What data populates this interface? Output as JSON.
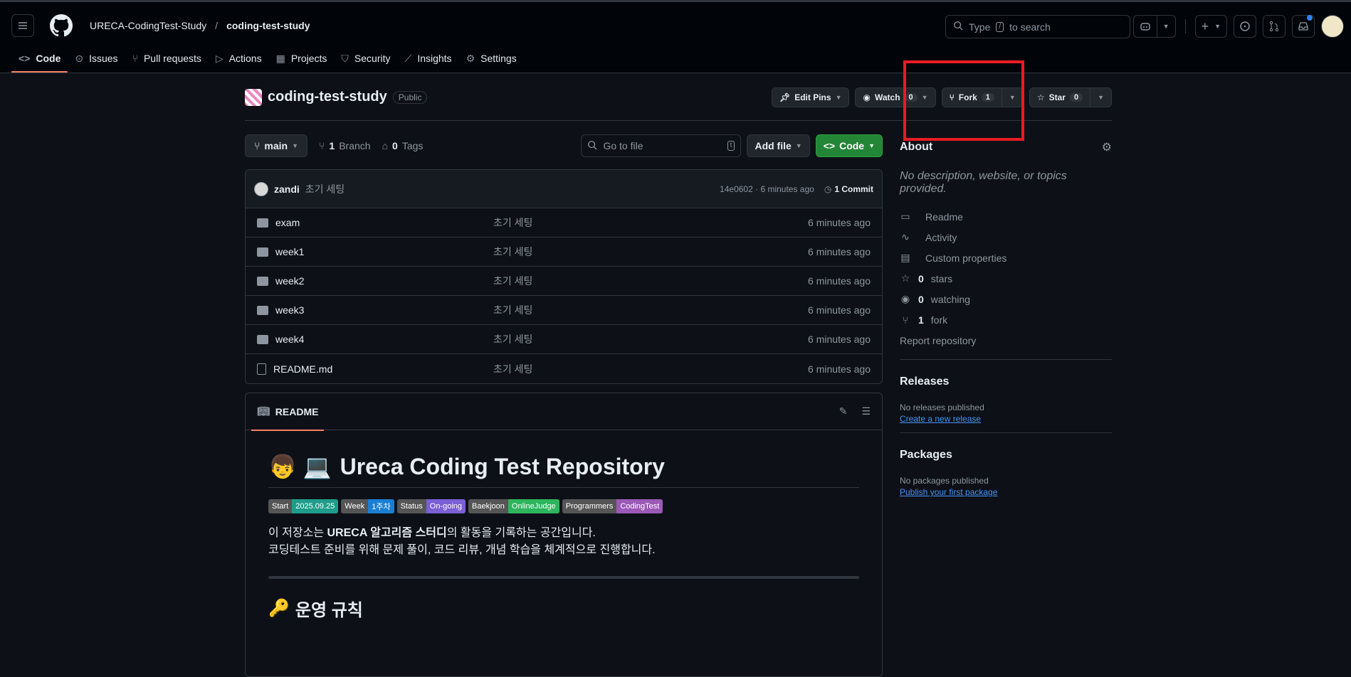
{
  "header": {
    "owner": "URECA-CodingTest-Study",
    "separator": "/",
    "repo": "coding-test-study",
    "search_placeholder_pre": "Type",
    "search_key": "/",
    "search_placeholder_post": "to search"
  },
  "tabs": [
    {
      "label": "Code",
      "icon": "code-icon"
    },
    {
      "label": "Issues",
      "icon": "issue-icon"
    },
    {
      "label": "Pull requests",
      "icon": "pull-request-icon"
    },
    {
      "label": "Actions",
      "icon": "play-icon"
    },
    {
      "label": "Projects",
      "icon": "table-icon"
    },
    {
      "label": "Security",
      "icon": "shield-icon"
    },
    {
      "label": "Insights",
      "icon": "graph-icon"
    },
    {
      "label": "Settings",
      "icon": "gear-icon"
    }
  ],
  "repo": {
    "name": "coding-test-study",
    "visibility": "Public",
    "edit_pins": "Edit Pins",
    "watch": "Watch",
    "watch_count": "0",
    "fork": "Fork",
    "fork_count": "1",
    "star": "Star",
    "star_count": "0"
  },
  "toolbar": {
    "branch": "main",
    "branch_count": "1",
    "branch_label": "Branch",
    "tag_count": "0",
    "tag_label": "Tags",
    "goto_placeholder": "Go to file",
    "goto_key": "t",
    "add_file": "Add file",
    "code": "Code"
  },
  "commit": {
    "author": "zandi",
    "message": "초기 세팅",
    "sha_time": "14e0602 · 6 minutes ago",
    "count": "1 Commit"
  },
  "files": [
    {
      "name": "exam",
      "type": "folder",
      "message": "초기 세팅",
      "time": "6 minutes ago"
    },
    {
      "name": "week1",
      "type": "folder",
      "message": "초기 세팅",
      "time": "6 minutes ago"
    },
    {
      "name": "week2",
      "type": "folder",
      "message": "초기 세팅",
      "time": "6 minutes ago"
    },
    {
      "name": "week3",
      "type": "folder",
      "message": "초기 세팅",
      "time": "6 minutes ago"
    },
    {
      "name": "week4",
      "type": "folder",
      "message": "초기 세팅",
      "time": "6 minutes ago"
    },
    {
      "name": "README.md",
      "type": "file",
      "message": "초기 세팅",
      "time": "6 minutes ago"
    }
  ],
  "readme": {
    "tab": "README",
    "title_emoji": "👦 💻",
    "title": "Ureca Coding Test Repository",
    "badges": [
      {
        "label": "Start",
        "value": "2025.09.25",
        "color": "#1f9c8a"
      },
      {
        "label": "Week",
        "value": "1주차",
        "color": "#1a7fd4"
      },
      {
        "label": "Status",
        "value": "On-going",
        "color": "#7b5fd6"
      },
      {
        "label": "Baekjoon",
        "value": "OnlineJudge",
        "color": "#2db55d"
      },
      {
        "label": "Programmers",
        "value": "CodingTest",
        "color": "#9b59b6"
      }
    ],
    "para_pre": "이 저장소는 ",
    "para_bold": "URECA 알고리즘 스터디",
    "para_post": "의 활동을 기록하는 공간입니다.",
    "para2": "코딩테스트 준비를 위해 문제 풀이, 코드 리뷰, 개념 학습을 체계적으로 진행합니다.",
    "h2_emoji": "🔑",
    "h2": "운영 규칙"
  },
  "about": {
    "title": "About",
    "description": "No description, website, or topics provided.",
    "items": [
      {
        "icon": "book-icon",
        "bold": "",
        "text": "Readme"
      },
      {
        "icon": "pulse-icon",
        "bold": "",
        "text": "Activity"
      },
      {
        "icon": "note-icon",
        "bold": "",
        "text": "Custom properties"
      },
      {
        "icon": "star-icon",
        "bold": "0",
        "text": "stars"
      },
      {
        "icon": "eye-icon",
        "bold": "0",
        "text": "watching"
      },
      {
        "icon": "fork-icon",
        "bold": "1",
        "text": "fork"
      }
    ],
    "report": "Report repository"
  },
  "releases": {
    "title": "Releases",
    "none": "No releases published",
    "link": "Create a new release"
  },
  "packages": {
    "title": "Packages",
    "none": "No packages published",
    "link": "Publish your first package"
  },
  "colors": {
    "accent_tab": "#f78166",
    "highlight_box": "#e81c24",
    "code_button": "#238636",
    "link": "#4493f8"
  }
}
